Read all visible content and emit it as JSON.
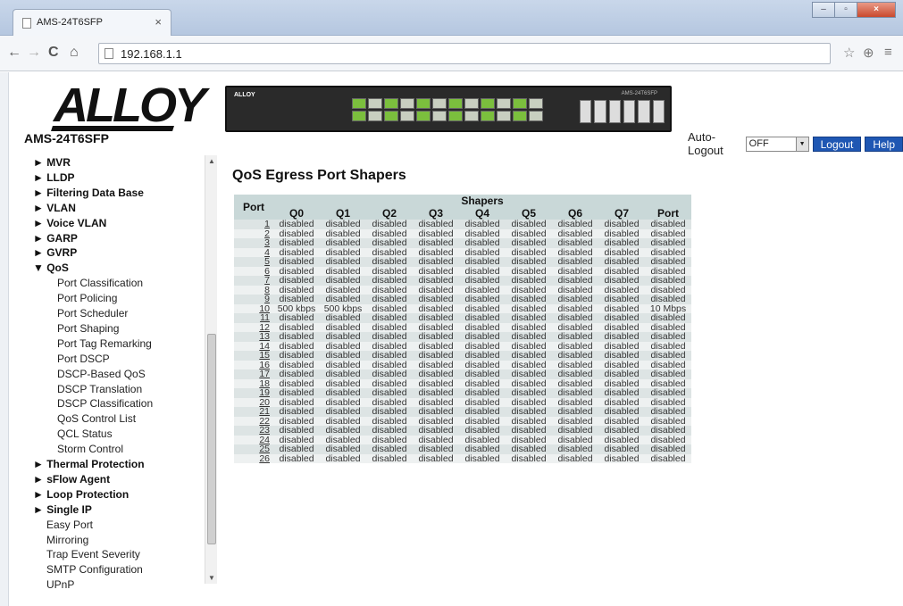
{
  "browser": {
    "tab_title": "AMS-24T6SFP",
    "tab_close": "×",
    "url": "192.168.1.1",
    "window_buttons": [
      "–",
      "▫",
      "×"
    ],
    "nav": {
      "back": "←",
      "forward": "→",
      "reload": "C",
      "home": "⌂"
    },
    "toolbar_icons": [
      "☆",
      "⊕",
      "≡"
    ]
  },
  "header": {
    "logo_text": "ALLOY",
    "model": "AMS-24T6SFP",
    "switch_brand": "ALLOY",
    "switch_model_label": "AMS-24T6SFP",
    "auto_logout_label": "Auto-Logout",
    "auto_logout_value": "OFF",
    "logout_label": "Logout",
    "help_label": "Help"
  },
  "sidebar": {
    "items": [
      {
        "label": "► MVR",
        "kind": "top"
      },
      {
        "label": "► LLDP",
        "kind": "top"
      },
      {
        "label": "► Filtering Data Base",
        "kind": "top"
      },
      {
        "label": "► VLAN",
        "kind": "top"
      },
      {
        "label": "► Voice VLAN",
        "kind": "top"
      },
      {
        "label": "► GARP",
        "kind": "top"
      },
      {
        "label": "► GVRP",
        "kind": "top"
      },
      {
        "label": "▼ QoS",
        "kind": "top"
      },
      {
        "label": "Port Classification",
        "kind": "sub"
      },
      {
        "label": "Port Policing",
        "kind": "sub"
      },
      {
        "label": "Port Scheduler",
        "kind": "sub"
      },
      {
        "label": "Port Shaping",
        "kind": "sub"
      },
      {
        "label": "Port Tag Remarking",
        "kind": "sub"
      },
      {
        "label": "Port DSCP",
        "kind": "sub"
      },
      {
        "label": "DSCP-Based QoS",
        "kind": "sub"
      },
      {
        "label": "DSCP Translation",
        "kind": "sub"
      },
      {
        "label": "DSCP Classification",
        "kind": "sub"
      },
      {
        "label": "QoS Control List",
        "kind": "sub"
      },
      {
        "label": "QCL Status",
        "kind": "sub"
      },
      {
        "label": "Storm Control",
        "kind": "sub"
      },
      {
        "label": "► Thermal Protection",
        "kind": "top"
      },
      {
        "label": "► sFlow Agent",
        "kind": "top"
      },
      {
        "label": "► Loop Protection",
        "kind": "top"
      },
      {
        "label": "► Single IP",
        "kind": "top"
      },
      {
        "label": "Easy Port",
        "kind": "plain"
      },
      {
        "label": "Mirroring",
        "kind": "plain"
      },
      {
        "label": "Trap Event Severity",
        "kind": "plain"
      },
      {
        "label": "SMTP Configuration",
        "kind": "plain"
      },
      {
        "label": "UPnP",
        "kind": "plain"
      }
    ]
  },
  "main": {
    "title": "QoS Egress Port Shapers",
    "table": {
      "port_header": "Port",
      "group_header": "Shapers",
      "columns": [
        "Q0",
        "Q1",
        "Q2",
        "Q3",
        "Q4",
        "Q5",
        "Q6",
        "Q7",
        "Port"
      ],
      "rows": [
        {
          "port": "1",
          "values": [
            "disabled",
            "disabled",
            "disabled",
            "disabled",
            "disabled",
            "disabled",
            "disabled",
            "disabled",
            "disabled"
          ]
        },
        {
          "port": "2",
          "values": [
            "disabled",
            "disabled",
            "disabled",
            "disabled",
            "disabled",
            "disabled",
            "disabled",
            "disabled",
            "disabled"
          ]
        },
        {
          "port": "3",
          "values": [
            "disabled",
            "disabled",
            "disabled",
            "disabled",
            "disabled",
            "disabled",
            "disabled",
            "disabled",
            "disabled"
          ]
        },
        {
          "port": "4",
          "values": [
            "disabled",
            "disabled",
            "disabled",
            "disabled",
            "disabled",
            "disabled",
            "disabled",
            "disabled",
            "disabled"
          ]
        },
        {
          "port": "5",
          "values": [
            "disabled",
            "disabled",
            "disabled",
            "disabled",
            "disabled",
            "disabled",
            "disabled",
            "disabled",
            "disabled"
          ]
        },
        {
          "port": "6",
          "values": [
            "disabled",
            "disabled",
            "disabled",
            "disabled",
            "disabled",
            "disabled",
            "disabled",
            "disabled",
            "disabled"
          ]
        },
        {
          "port": "7",
          "values": [
            "disabled",
            "disabled",
            "disabled",
            "disabled",
            "disabled",
            "disabled",
            "disabled",
            "disabled",
            "disabled"
          ]
        },
        {
          "port": "8",
          "values": [
            "disabled",
            "disabled",
            "disabled",
            "disabled",
            "disabled",
            "disabled",
            "disabled",
            "disabled",
            "disabled"
          ]
        },
        {
          "port": "9",
          "values": [
            "disabled",
            "disabled",
            "disabled",
            "disabled",
            "disabled",
            "disabled",
            "disabled",
            "disabled",
            "disabled"
          ]
        },
        {
          "port": "10",
          "values": [
            "500 kbps",
            "500 kbps",
            "disabled",
            "disabled",
            "disabled",
            "disabled",
            "disabled",
            "disabled",
            "10 Mbps"
          ]
        },
        {
          "port": "11",
          "values": [
            "disabled",
            "disabled",
            "disabled",
            "disabled",
            "disabled",
            "disabled",
            "disabled",
            "disabled",
            "disabled"
          ]
        },
        {
          "port": "12",
          "values": [
            "disabled",
            "disabled",
            "disabled",
            "disabled",
            "disabled",
            "disabled",
            "disabled",
            "disabled",
            "disabled"
          ]
        },
        {
          "port": "13",
          "values": [
            "disabled",
            "disabled",
            "disabled",
            "disabled",
            "disabled",
            "disabled",
            "disabled",
            "disabled",
            "disabled"
          ]
        },
        {
          "port": "14",
          "values": [
            "disabled",
            "disabled",
            "disabled",
            "disabled",
            "disabled",
            "disabled",
            "disabled",
            "disabled",
            "disabled"
          ]
        },
        {
          "port": "15",
          "values": [
            "disabled",
            "disabled",
            "disabled",
            "disabled",
            "disabled",
            "disabled",
            "disabled",
            "disabled",
            "disabled"
          ]
        },
        {
          "port": "16",
          "values": [
            "disabled",
            "disabled",
            "disabled",
            "disabled",
            "disabled",
            "disabled",
            "disabled",
            "disabled",
            "disabled"
          ]
        },
        {
          "port": "17",
          "values": [
            "disabled",
            "disabled",
            "disabled",
            "disabled",
            "disabled",
            "disabled",
            "disabled",
            "disabled",
            "disabled"
          ]
        },
        {
          "port": "18",
          "values": [
            "disabled",
            "disabled",
            "disabled",
            "disabled",
            "disabled",
            "disabled",
            "disabled",
            "disabled",
            "disabled"
          ]
        },
        {
          "port": "19",
          "values": [
            "disabled",
            "disabled",
            "disabled",
            "disabled",
            "disabled",
            "disabled",
            "disabled",
            "disabled",
            "disabled"
          ]
        },
        {
          "port": "20",
          "values": [
            "disabled",
            "disabled",
            "disabled",
            "disabled",
            "disabled",
            "disabled",
            "disabled",
            "disabled",
            "disabled"
          ]
        },
        {
          "port": "21",
          "values": [
            "disabled",
            "disabled",
            "disabled",
            "disabled",
            "disabled",
            "disabled",
            "disabled",
            "disabled",
            "disabled"
          ]
        },
        {
          "port": "22",
          "values": [
            "disabled",
            "disabled",
            "disabled",
            "disabled",
            "disabled",
            "disabled",
            "disabled",
            "disabled",
            "disabled"
          ]
        },
        {
          "port": "23",
          "values": [
            "disabled",
            "disabled",
            "disabled",
            "disabled",
            "disabled",
            "disabled",
            "disabled",
            "disabled",
            "disabled"
          ]
        },
        {
          "port": "24",
          "values": [
            "disabled",
            "disabled",
            "disabled",
            "disabled",
            "disabled",
            "disabled",
            "disabled",
            "disabled",
            "disabled"
          ]
        },
        {
          "port": "25",
          "values": [
            "disabled",
            "disabled",
            "disabled",
            "disabled",
            "disabled",
            "disabled",
            "disabled",
            "disabled",
            "disabled"
          ]
        },
        {
          "port": "26",
          "values": [
            "disabled",
            "disabled",
            "disabled",
            "disabled",
            "disabled",
            "disabled",
            "disabled",
            "disabled",
            "disabled"
          ]
        }
      ]
    }
  }
}
